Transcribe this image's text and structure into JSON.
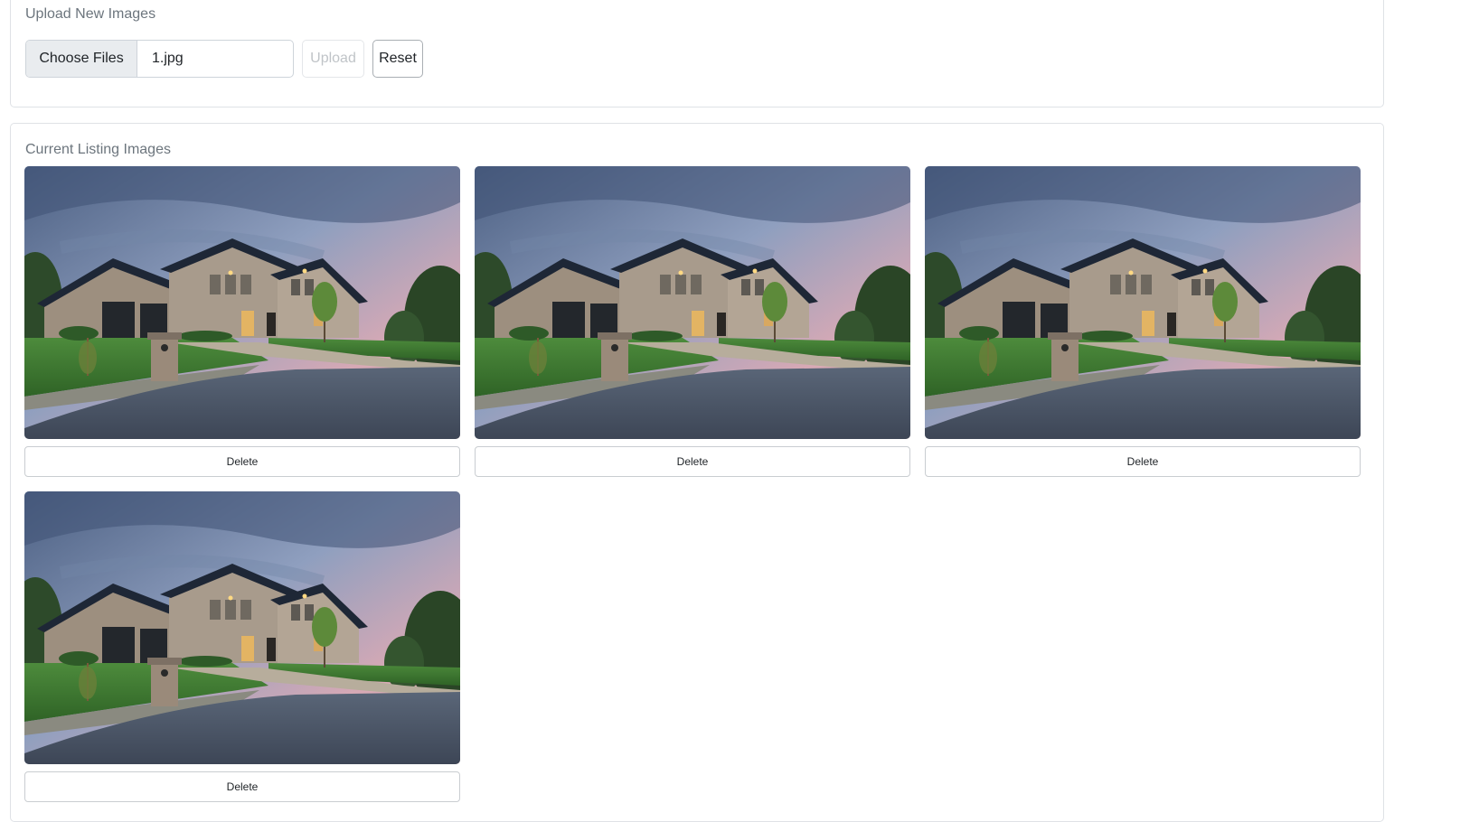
{
  "upload_section": {
    "title": "Upload New Images",
    "choose_files_label": "Choose Files",
    "selected_file": "1.jpg",
    "upload_label": "Upload",
    "upload_disabled": true,
    "reset_label": "Reset"
  },
  "images_section": {
    "title": "Current Listing Images",
    "images": [
      {
        "alt": "House exterior at dusk",
        "delete_label": "Delete"
      },
      {
        "alt": "House exterior at dusk",
        "delete_label": "Delete"
      },
      {
        "alt": "House exterior at dusk",
        "delete_label": "Delete"
      },
      {
        "alt": "House exterior at dusk",
        "delete_label": "Delete"
      }
    ]
  },
  "colors": {
    "card_border": "#dfe2e6",
    "muted_text": "#6c757d",
    "file_button_bg": "#e9ecef"
  }
}
